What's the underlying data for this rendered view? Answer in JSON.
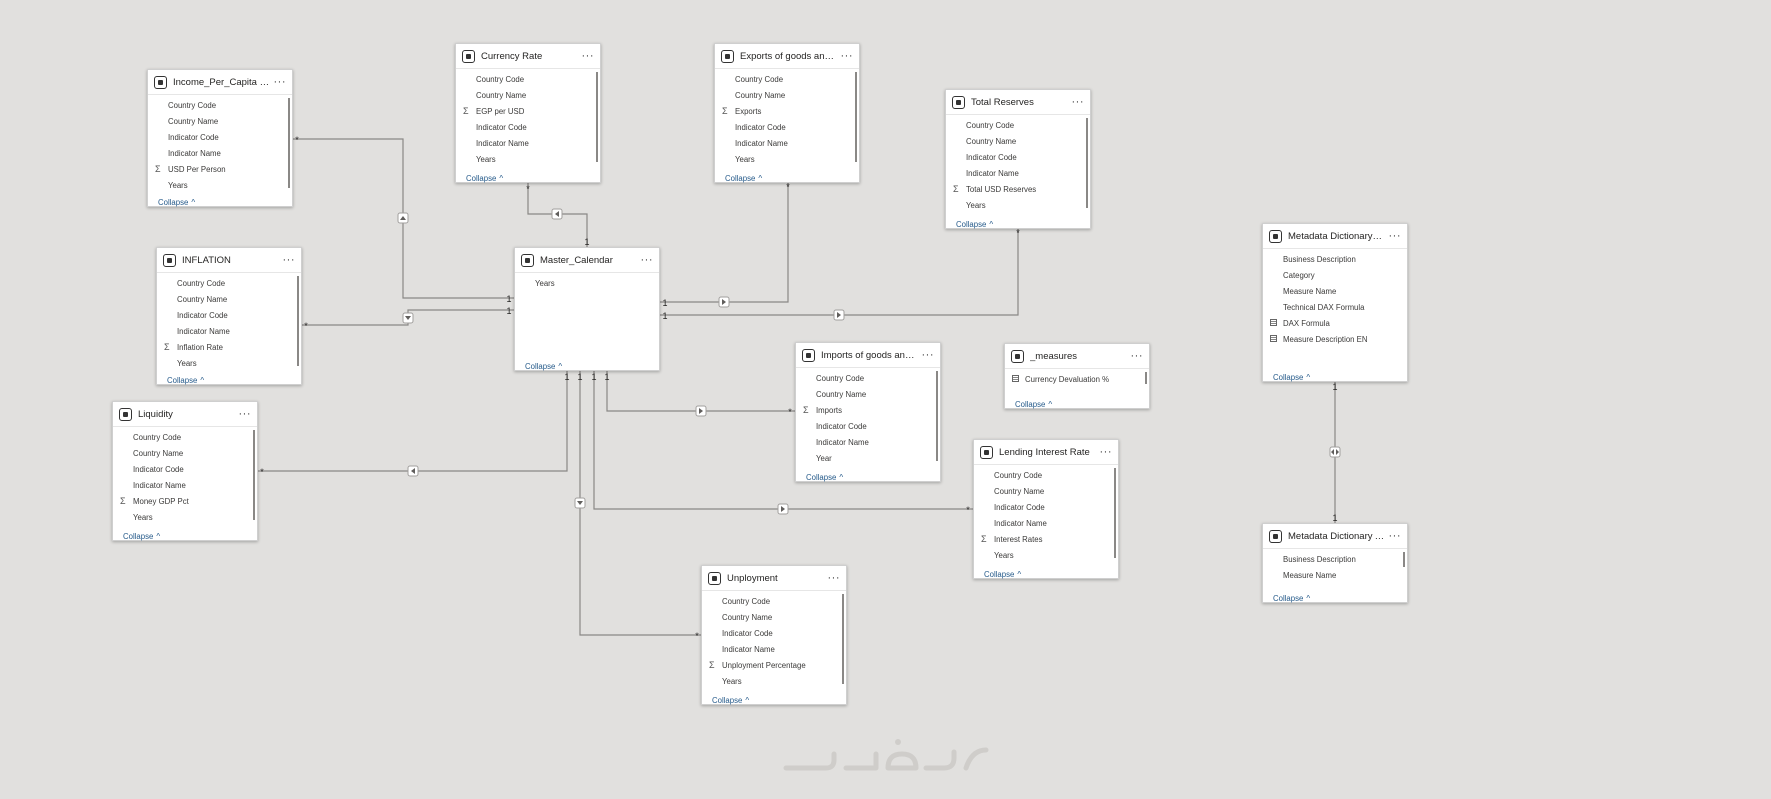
{
  "tables": [
    {
      "key": "income",
      "title": "Income_Per_Capita (USD)",
      "fields": [
        {
          "name": "Country Code",
          "kind": "plain"
        },
        {
          "name": "Country Name",
          "kind": "plain"
        },
        {
          "name": "Indicator Code",
          "kind": "plain"
        },
        {
          "name": "Indicator Name",
          "kind": "plain"
        },
        {
          "name": "USD Per Person",
          "kind": "sum"
        },
        {
          "name": "Years",
          "kind": "plain"
        }
      ],
      "collapse": "Collapse"
    },
    {
      "key": "currency",
      "title": "Currency Rate",
      "fields": [
        {
          "name": "Country Code",
          "kind": "plain"
        },
        {
          "name": "Country Name",
          "kind": "plain"
        },
        {
          "name": "EGP per USD",
          "kind": "sum"
        },
        {
          "name": "Indicator Code",
          "kind": "plain"
        },
        {
          "name": "Indicator Name",
          "kind": "plain"
        },
        {
          "name": "Years",
          "kind": "plain"
        }
      ],
      "collapse": "Collapse"
    },
    {
      "key": "exports",
      "title": "Exports of goods and s...",
      "fields": [
        {
          "name": "Country Code",
          "kind": "plain"
        },
        {
          "name": "Country Name",
          "kind": "plain"
        },
        {
          "name": "Exports",
          "kind": "sum"
        },
        {
          "name": "Indicator Code",
          "kind": "plain"
        },
        {
          "name": "Indicator Name",
          "kind": "plain"
        },
        {
          "name": "Years",
          "kind": "plain"
        }
      ],
      "collapse": "Collapse"
    },
    {
      "key": "reserves",
      "title": "Total Reserves",
      "fields": [
        {
          "name": "Country Code",
          "kind": "plain"
        },
        {
          "name": "Country Name",
          "kind": "plain"
        },
        {
          "name": "Indicator Code",
          "kind": "plain"
        },
        {
          "name": "Indicator Name",
          "kind": "plain"
        },
        {
          "name": "Total USD Reserves",
          "kind": "sum"
        },
        {
          "name": "Years",
          "kind": "plain"
        }
      ],
      "collapse": "Collapse"
    },
    {
      "key": "inflation",
      "title": "INFLATION",
      "fields": [
        {
          "name": "Country Code",
          "kind": "plain"
        },
        {
          "name": "Country Name",
          "kind": "plain"
        },
        {
          "name": "Indicator Code",
          "kind": "plain"
        },
        {
          "name": "Indicator Name",
          "kind": "plain"
        },
        {
          "name": "Inflation Rate",
          "kind": "sum"
        },
        {
          "name": "Years",
          "kind": "plain"
        }
      ],
      "collapse": "Collapse"
    },
    {
      "key": "calendar",
      "title": "Master_Calendar",
      "fields": [
        {
          "name": "Years",
          "kind": "plain"
        }
      ],
      "collapse": "Collapse"
    },
    {
      "key": "imports",
      "title": "Imports of goods and s...",
      "fields": [
        {
          "name": "Country Code",
          "kind": "plain"
        },
        {
          "name": "Country Name",
          "kind": "plain"
        },
        {
          "name": "Imports",
          "kind": "sum"
        },
        {
          "name": "Indicator Code",
          "kind": "plain"
        },
        {
          "name": "Indicator Name",
          "kind": "plain"
        },
        {
          "name": "Year",
          "kind": "plain"
        }
      ],
      "collapse": "Collapse"
    },
    {
      "key": "measures",
      "title": "_measures",
      "fields": [
        {
          "name": "Currency Devaluation %",
          "kind": "measure"
        }
      ],
      "collapse": "Collapse"
    },
    {
      "key": "liquidity",
      "title": "Liquidity",
      "fields": [
        {
          "name": "Country Code",
          "kind": "plain"
        },
        {
          "name": "Country Name",
          "kind": "plain"
        },
        {
          "name": "Indicator Code",
          "kind": "plain"
        },
        {
          "name": "Indicator Name",
          "kind": "plain"
        },
        {
          "name": "Money GDP Pct",
          "kind": "sum"
        },
        {
          "name": "Years",
          "kind": "plain"
        }
      ],
      "collapse": "Collapse"
    },
    {
      "key": "lending",
      "title": "Lending Interest Rate",
      "fields": [
        {
          "name": "Country Code",
          "kind": "plain"
        },
        {
          "name": "Country Name",
          "kind": "plain"
        },
        {
          "name": "Indicator Code",
          "kind": "plain"
        },
        {
          "name": "Indicator Name",
          "kind": "plain"
        },
        {
          "name": "Interest Rates",
          "kind": "sum"
        },
        {
          "name": "Years",
          "kind": "plain"
        }
      ],
      "collapse": "Collapse"
    },
    {
      "key": "unployment",
      "title": "Unployment",
      "fields": [
        {
          "name": "Country Code",
          "kind": "plain"
        },
        {
          "name": "Country Name",
          "kind": "plain"
        },
        {
          "name": "Indicator Code",
          "kind": "plain"
        },
        {
          "name": "Indicator Name",
          "kind": "plain"
        },
        {
          "name": "Unployment Percentage",
          "kind": "sum"
        },
        {
          "name": "Years",
          "kind": "plain"
        }
      ],
      "collapse": "Collapse"
    },
    {
      "key": "meta_en",
      "title": "Metadata Dictionary EN",
      "fields": [
        {
          "name": "Business Description",
          "kind": "plain"
        },
        {
          "name": "Category",
          "kind": "plain"
        },
        {
          "name": "Measure Name",
          "kind": "plain"
        },
        {
          "name": "Technical DAX Formula",
          "kind": "plain"
        },
        {
          "name": "DAX Formula",
          "kind": "measure"
        },
        {
          "name": "Measure Description EN",
          "kind": "measure"
        }
      ],
      "collapse": "Collapse"
    },
    {
      "key": "meta_ar",
      "title": "Metadata Dictionary AR",
      "fields": [
        {
          "name": "Business Description",
          "kind": "plain"
        },
        {
          "name": "Measure Name",
          "kind": "plain"
        }
      ],
      "collapse": "Collapse"
    }
  ],
  "cardinality": {
    "one": "1",
    "many": "*"
  },
  "icons": {
    "table": "table-icon",
    "more": "more-options-icon",
    "sum": "sigma-icon",
    "measure": "calculator-icon",
    "chevron": "chevron-up-icon"
  },
  "colors": {
    "background": "#e1e0de",
    "card": "#ffffff",
    "line": "#8a8886",
    "link": "#255a8a"
  }
}
